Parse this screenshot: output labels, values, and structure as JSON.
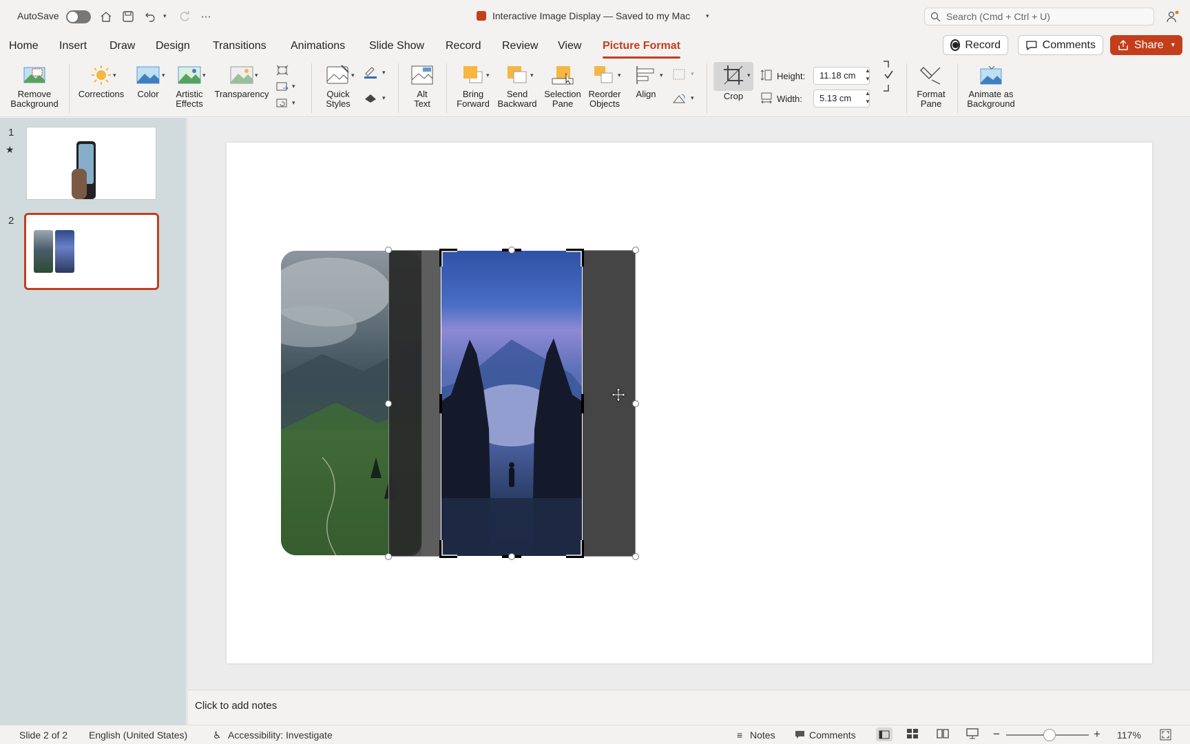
{
  "titlebar": {
    "autosave_label": "AutoSave",
    "doc_title": "Interactive Image Display — Saved to my Mac",
    "search_placeholder": "Search (Cmd + Ctrl + U)"
  },
  "tabs": [
    "Home",
    "Insert",
    "Draw",
    "Design",
    "Transitions",
    "Animations",
    "Slide Show",
    "Record",
    "Review",
    "View",
    "Picture Format"
  ],
  "active_tab": "Picture Format",
  "top_buttons": {
    "record": "Record",
    "comments": "Comments",
    "share": "Share"
  },
  "ribbon": {
    "remove_background": [
      "Remove",
      "Background"
    ],
    "corrections": "Corrections",
    "color": "Color",
    "artistic_effects": [
      "Artistic",
      "Effects"
    ],
    "transparency": "Transparency",
    "quick_styles": [
      "Quick",
      "Styles"
    ],
    "alt_text": [
      "Alt",
      "Text"
    ],
    "bring_forward": [
      "Bring",
      "Forward"
    ],
    "send_backward": [
      "Send",
      "Backward"
    ],
    "selection_pane": [
      "Selection",
      "Pane"
    ],
    "reorder_objects": [
      "Reorder",
      "Objects"
    ],
    "align": "Align",
    "crop": "Crop",
    "height_label": "Height:",
    "height_value": "11.18 cm",
    "width_label": "Width:",
    "width_value": "5.13 cm",
    "format_pane": [
      "Format",
      "Pane"
    ],
    "animate_as_background": [
      "Animate as",
      "Background"
    ]
  },
  "slides_panel": [
    {
      "number": "1"
    },
    {
      "number": "2"
    }
  ],
  "notes_placeholder": "Click to add notes",
  "status": {
    "slide_info": "Slide 2 of 2",
    "language": "English (United States)",
    "accessibility": "Accessibility: Investigate",
    "notes": "Notes",
    "comments": "Comments",
    "zoom": "117%"
  },
  "colors": {
    "accent": "#c43e1c",
    "panel": "#d1dbde"
  }
}
